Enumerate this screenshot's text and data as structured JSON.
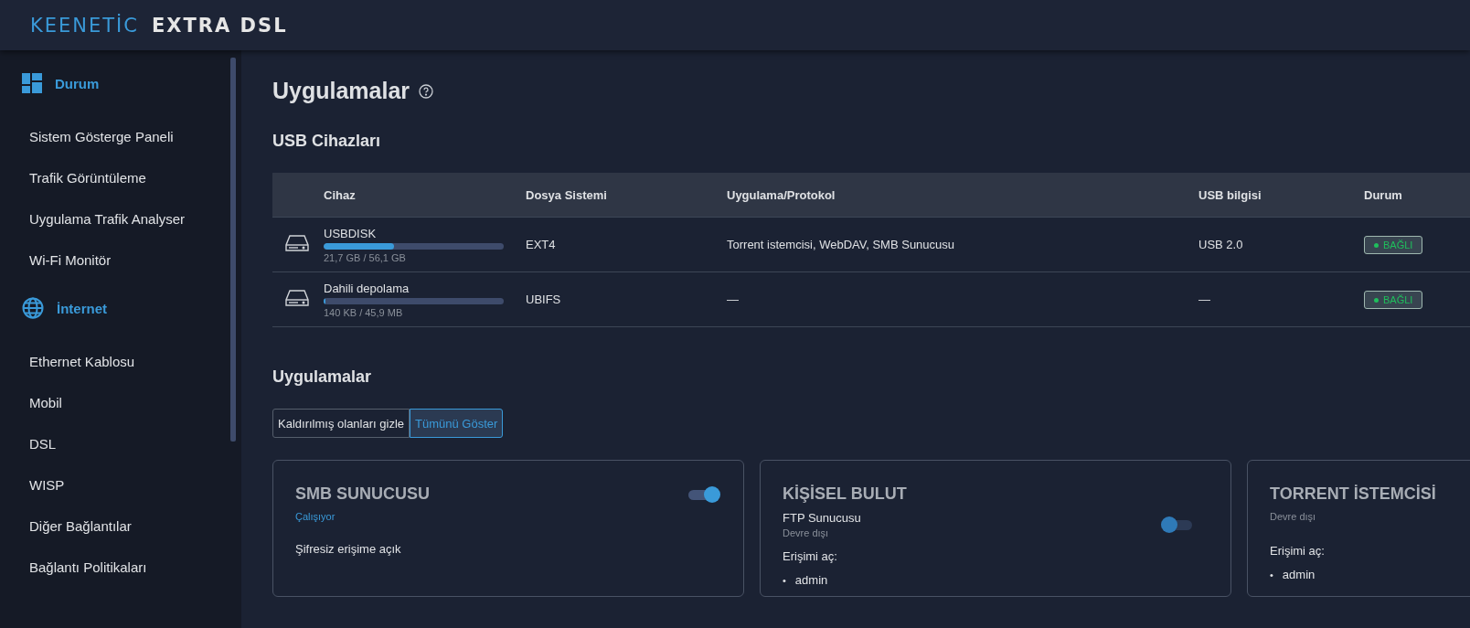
{
  "header": {
    "brand": [
      {
        "text": "KEENETİC",
        "accent": true
      },
      {
        "text": "EXTRA DSL",
        "accent": false
      }
    ]
  },
  "sidebar": {
    "sections": [
      {
        "title": "Durum",
        "items": [
          "Sistem Gösterge Paneli",
          "Trafik Görüntüleme",
          "Uygulama Trafik Analyser",
          "Wi-Fi Monitör"
        ]
      },
      {
        "title": "İnternet",
        "items": [
          "Ethernet Kablosu",
          "Mobil",
          "DSL",
          "WISP",
          "Diğer Bağlantılar",
          "Bağlantı Politikaları"
        ]
      }
    ]
  },
  "page": {
    "title": "Uygulamalar"
  },
  "usb_section": {
    "title": "USB Cihazları",
    "table": {
      "columns": [
        "Cihaz",
        "Dosya Sistemi",
        "Uygulama/Protokol",
        "USB bilgisi",
        "Durum"
      ],
      "rows": [
        {
          "name": "USBDISK",
          "level": 0.39,
          "usage": "21,7 GB / 56,1 GB",
          "filesystem": "EXT4",
          "apps": "Torrent istemcisi, WebDAV, SMB Sunucusu",
          "usb": "USB 2.0",
          "status": "BAĞLI"
        },
        {
          "name": "Dahili depolama",
          "level": 0.01,
          "usage": "140 KB / 45,9 MB",
          "filesystem": "UBIFS",
          "apps": "—",
          "usb": "—",
          "status": "BAĞLI"
        }
      ]
    }
  },
  "apps_section": {
    "title": "Uygulamalar",
    "filters": [
      {
        "label": "Kaldırılmış olanları gizle",
        "selected": false
      },
      {
        "label": "Tümünü Göster",
        "selected": true
      }
    ],
    "cards": [
      {
        "title": "SMB SUNUCUSU",
        "toggle": {
          "on": true
        },
        "status": "Çalışıyor",
        "running": true,
        "body": [
          {
            "kind": "text",
            "text": "Şifresiz erişime açık"
          }
        ]
      },
      {
        "title": "KİŞİSEL BULUT",
        "body": [
          {
            "kind": "service",
            "name": "FTP Sunucusu",
            "status": "Devre dışı",
            "on": false
          },
          {
            "kind": "access",
            "label": "Erişimi aç:",
            "users": [
              {
                "bullet": "•",
                "name": "admin"
              }
            ]
          }
        ]
      },
      {
        "title": "TORRENT İSTEMCİSİ",
        "status": "Devre dışı",
        "running": false,
        "body": [
          {
            "kind": "access",
            "label": "Erişimi aç:",
            "users": [
              {
                "bullet": "•",
                "name": "admin"
              }
            ]
          }
        ]
      }
    ]
  }
}
